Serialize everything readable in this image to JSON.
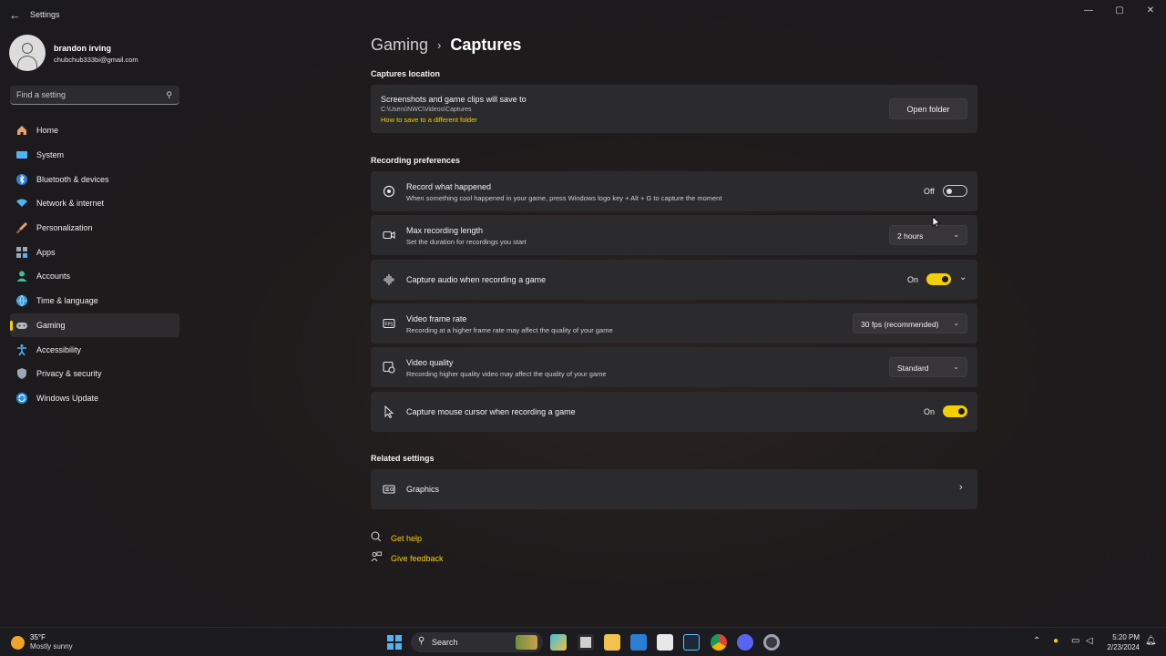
{
  "window": {
    "title": "Settings",
    "controls": [
      "—",
      "▢",
      "✕"
    ]
  },
  "profile": {
    "name": "brandon irving",
    "email": "chubchub333bi@gmail.com"
  },
  "search": {
    "placeholder": "Find a setting"
  },
  "sidebar": {
    "items": [
      {
        "label": "Home",
        "icon": "home-icon"
      },
      {
        "label": "System",
        "icon": "system-icon"
      },
      {
        "label": "Bluetooth & devices",
        "icon": "bluetooth-icon"
      },
      {
        "label": "Network & internet",
        "icon": "wifi-icon"
      },
      {
        "label": "Personalization",
        "icon": "brush-icon"
      },
      {
        "label": "Apps",
        "icon": "apps-icon"
      },
      {
        "label": "Accounts",
        "icon": "accounts-icon"
      },
      {
        "label": "Time & language",
        "icon": "globe-icon"
      },
      {
        "label": "Gaming",
        "icon": "gamepad-icon",
        "active": true
      },
      {
        "label": "Accessibility",
        "icon": "accessibility-icon"
      },
      {
        "label": "Privacy & security",
        "icon": "shield-icon"
      },
      {
        "label": "Windows Update",
        "icon": "update-icon"
      }
    ]
  },
  "breadcrumb": {
    "parent": "Gaming",
    "separator": "›",
    "current": "Captures"
  },
  "captures_location": {
    "section_title": "Captures location",
    "title": "Screenshots and game clips will save to",
    "path": "C:\\Users\\NWC\\Videos\\Captures",
    "link": "How to save to a different folder",
    "button": "Open folder"
  },
  "recording": {
    "section_title": "Recording preferences",
    "record_what_happened": {
      "title": "Record what happened",
      "desc": "When something cool happened in your game, press Windows logo key + Alt + G to capture the moment",
      "state": "Off"
    },
    "max_length": {
      "title": "Max recording length",
      "desc": "Set the duration for recordings you start",
      "value": "2 hours"
    },
    "capture_audio": {
      "title": "Capture audio when recording a game",
      "state": "On"
    },
    "frame_rate": {
      "title": "Video frame rate",
      "desc": "Recording at a higher frame rate may affect the quality of your game",
      "value": "30 fps (recommended)"
    },
    "quality": {
      "title": "Video quality",
      "desc": "Recording higher quality video may affect the quality of your game",
      "value": "Standard"
    },
    "mouse_cursor": {
      "title": "Capture mouse cursor when recording a game",
      "state": "On"
    }
  },
  "related": {
    "section_title": "Related settings",
    "graphics": "Graphics"
  },
  "help": {
    "get_help": "Get help",
    "give_feedback": "Give feedback"
  },
  "taskbar": {
    "temp": "35°F",
    "condition": "Mostly sunny",
    "search": "Search",
    "time": "5:20 PM",
    "date": "2/23/2024"
  },
  "colors": {
    "accent": "#f5d000",
    "card": "#2b2a2c",
    "background": "#1f1b1c"
  }
}
